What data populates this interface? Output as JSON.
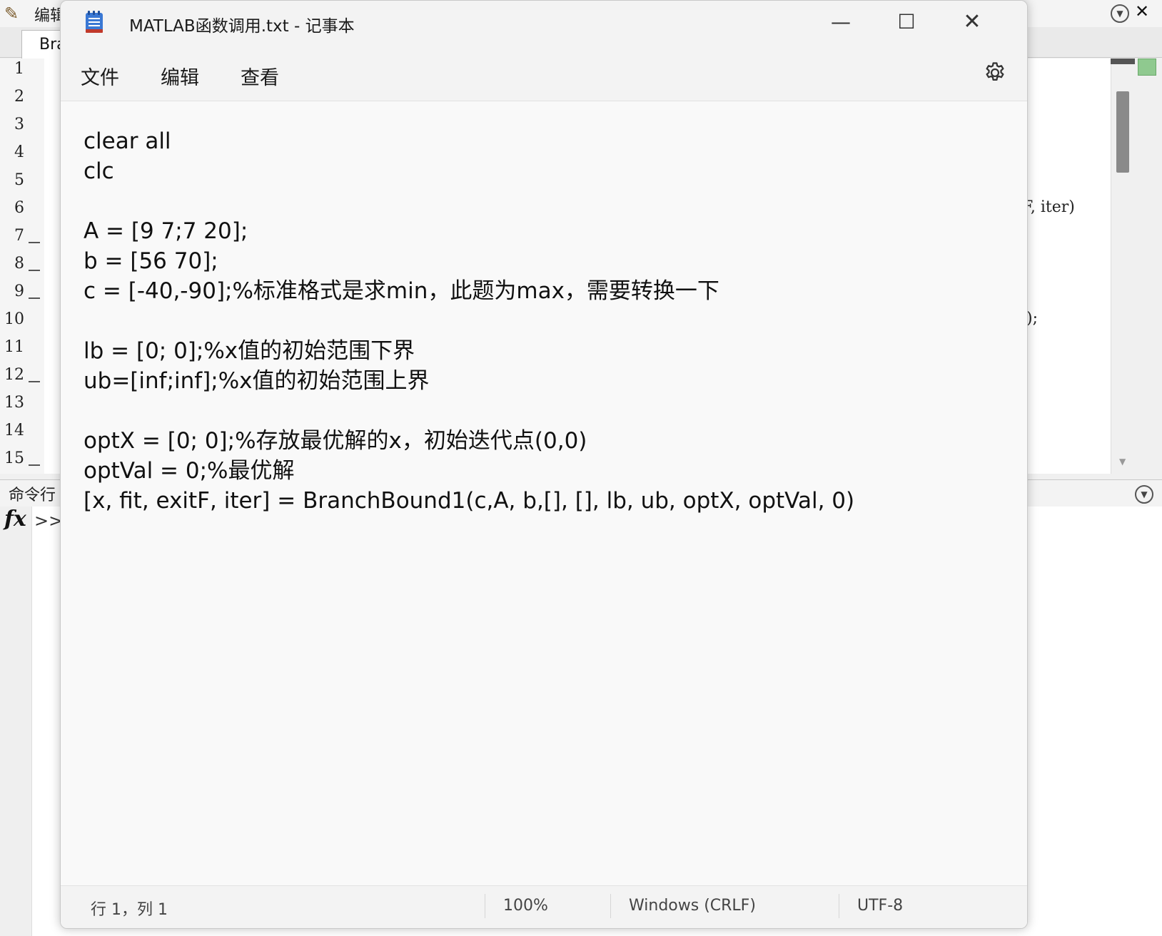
{
  "matlab": {
    "title": "编辑",
    "tab_label": "Bra",
    "line_numbers": [
      "1",
      "2",
      "3",
      "4",
      "5",
      "6",
      "7",
      "8",
      "9",
      "10",
      "11",
      "12",
      "13",
      "14",
      "15"
    ],
    "code_fragment_iter": "F,  iter)",
    "code_fragment_semicolon": ");",
    "command_window_title": "命令行",
    "fx_label": "fx",
    "prompt": ">>"
  },
  "notepad": {
    "title": "MATLAB函数调用.txt - 记事本",
    "menu": {
      "file": "文件",
      "edit": "编辑",
      "view": "查看"
    },
    "lines": [
      "clear all",
      "clc",
      "",
      "A = [9 7;7 20];",
      "b = [56 70];",
      "c = [-40,-90];%标准格式是求min，此题为max，需要转换一下",
      "",
      "lb = [0; 0];%x值的初始范围下界",
      "ub=[inf;inf];%x值的初始范围上界",
      "",
      "optX = [0; 0];%存放最优解的x，初始迭代点(0,0)",
      "optVal = 0;%最优解",
      "[x, fit, exitF, iter] = BranchBound1(c,A, b,[], [], lb, ub, optX, optVal, 0)"
    ],
    "status": {
      "position": "行 1，列 1",
      "zoom": "100%",
      "line_ending": "Windows (CRLF)",
      "encoding": "UTF-8"
    },
    "colors": {
      "accent_icon": "#3a78d4",
      "window_bg": "#f9f9f9"
    }
  }
}
